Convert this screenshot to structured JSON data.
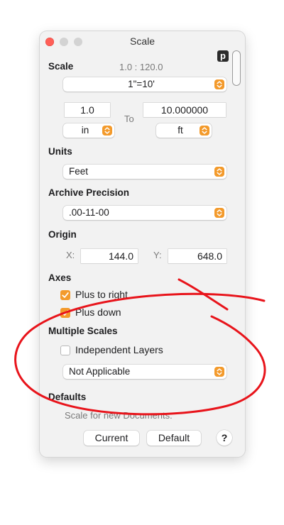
{
  "window": {
    "title": "Scale"
  },
  "scale": {
    "label": "Scale",
    "ratio": "1.0 : 120.0",
    "preset": "1\"=10'",
    "from_value": "1.0",
    "to_label": "To",
    "to_value": "10.000000",
    "from_unit": "in",
    "to_unit": "ft"
  },
  "units": {
    "label": "Units",
    "value": "Feet"
  },
  "archive": {
    "label": "Archive Precision",
    "value": ".00-11-00"
  },
  "origin": {
    "label": "Origin",
    "x_label": "X:",
    "x_value": "144.0",
    "y_label": "Y:",
    "y_value": "648.0"
  },
  "axes": {
    "label": "Axes",
    "plus_right": "Plus to right",
    "plus_down": "Plus down",
    "plus_right_checked": true,
    "plus_down_checked": true
  },
  "multiple": {
    "label": "Multiple Scales",
    "independent_layers": "Independent Layers",
    "independent_checked": false,
    "mode": "Not Applicable"
  },
  "defaults": {
    "label": "Defaults",
    "note": "Scale for new Documents:",
    "current_button": "Current",
    "default_button": "Default",
    "help": "?"
  },
  "badge": "p",
  "colors": {
    "accent": "#f39a2b",
    "annotation": "#e8141b"
  }
}
